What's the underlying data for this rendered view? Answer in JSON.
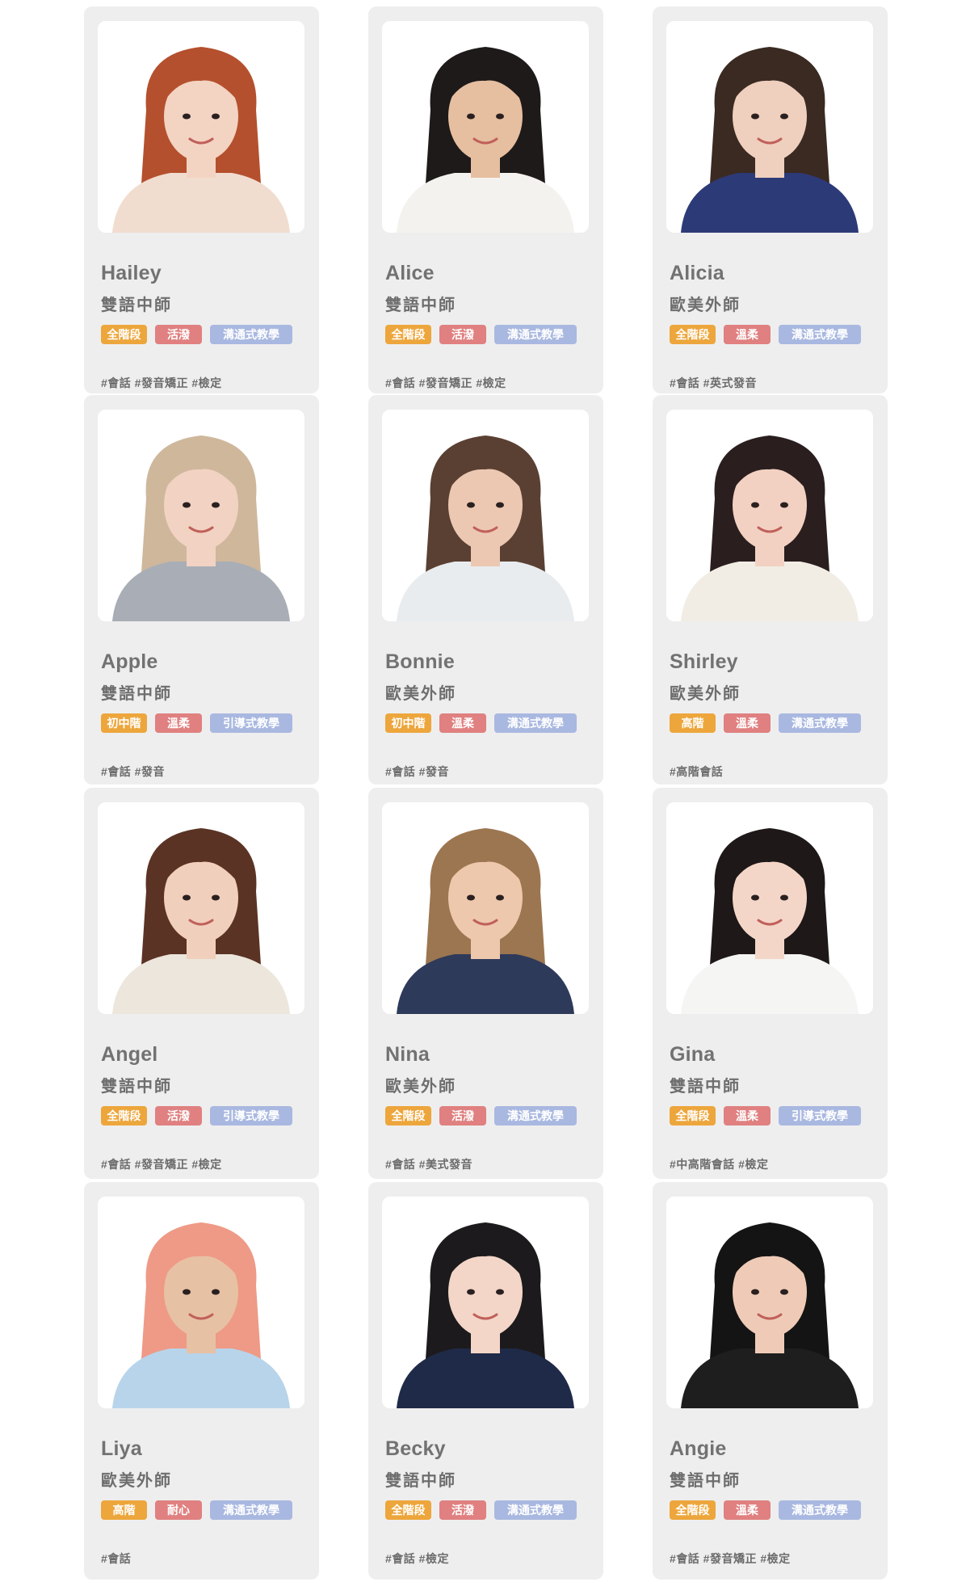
{
  "teachers": [
    {
      "name": "Hailey",
      "role": "雙語中師",
      "tags": [
        "全階段",
        "活潑",
        "溝通式教學"
      ],
      "hashtags": "#會話 #發音矯正 #檢定",
      "hair": "#b4502e",
      "shirt": "#f1ddd0",
      "skin": "#f3d3c2",
      "bg": "#ffffff"
    },
    {
      "name": "Alice",
      "role": "雙語中師",
      "tags": [
        "全階段",
        "活潑",
        "溝通式教學"
      ],
      "hashtags": "#會話 #發音矯正 #檢定",
      "hair": "#1e1a1a",
      "shirt": "#f4f2ee",
      "skin": "#e6bea0",
      "bg": "#ffffff"
    },
    {
      "name": "Alicia",
      "role": "歐美外師",
      "tags": [
        "全階段",
        "溫柔",
        "溝通式教學"
      ],
      "hashtags": "#會話 #英式發音",
      "hair": "#3a2a22",
      "shirt": "#2d3a78",
      "skin": "#efcfbd",
      "bg": "#ffffff"
    },
    {
      "name": "Apple",
      "role": "雙語中師",
      "tags": [
        "初中階",
        "溫柔",
        "引導式教學"
      ],
      "hashtags": "#會話 #發音",
      "hair": "#cfb79c",
      "shirt": "#a9aeb6",
      "skin": "#f2d2c2",
      "bg": "#ffffff"
    },
    {
      "name": "Bonnie",
      "role": "歐美外師",
      "tags": [
        "初中階",
        "溫柔",
        "溝通式教學"
      ],
      "hashtags": "#會話 #發音",
      "hair": "#5a4032",
      "shirt": "#e8ecef",
      "skin": "#ecc8b2",
      "bg": "#ffffff"
    },
    {
      "name": "Shirley",
      "role": "歐美外師",
      "tags": [
        "高階",
        "溫柔",
        "溝通式教學"
      ],
      "hashtags": "#高階會話",
      "hair": "#2a1e1e",
      "shirt": "#f1ede4",
      "skin": "#f3d1c2",
      "bg": "#ffffff"
    },
    {
      "name": "Angel",
      "role": "雙語中師",
      "tags": [
        "全階段",
        "活潑",
        "引導式教學"
      ],
      "hashtags": "#會話 #發音矯正 #檢定",
      "hair": "#5b3324",
      "shirt": "#ece6dc",
      "skin": "#f1cfbd",
      "bg": "#ffffff"
    },
    {
      "name": "Nina",
      "role": "歐美外師",
      "tags": [
        "全階段",
        "活潑",
        "溝通式教學"
      ],
      "hashtags": "#會話 #美式發音",
      "hair": "#9c7650",
      "shirt": "#2e3a5a",
      "skin": "#eec8ad",
      "bg": "#ffffff"
    },
    {
      "name": "Gina",
      "role": "雙語中師",
      "tags": [
        "全階段",
        "溫柔",
        "引導式教學"
      ],
      "hashtags": "#中高階會話 #檢定",
      "hair": "#1e1818",
      "shirt": "#f5f5f3",
      "skin": "#f4d6c8",
      "bg": "#ffffff"
    },
    {
      "name": "Liya",
      "role": "歐美外師",
      "tags": [
        "高階",
        "耐心",
        "溝通式教學"
      ],
      "hashtags": "#會話",
      "hair": "#ee9a86",
      "shirt": "#b8d4ea",
      "skin": "#e7c1a4",
      "bg": "#ffffff"
    },
    {
      "name": "Becky",
      "role": "雙語中師",
      "tags": [
        "全階段",
        "活潑",
        "溝通式教學"
      ],
      "hashtags": "#會話 #檢定",
      "hair": "#1c1a1c",
      "shirt": "#1f2a48",
      "skin": "#f3d6c8",
      "bg": "#ffffff"
    },
    {
      "name": "Angie",
      "role": "雙語中師",
      "tags": [
        "全階段",
        "溫柔",
        "溝通式教學"
      ],
      "hashtags": "#會話 #發音矯正 #檢定",
      "hair": "#141414",
      "shirt": "#1e1e1e",
      "skin": "#efcbb7",
      "bg": "#ffffff"
    }
  ]
}
